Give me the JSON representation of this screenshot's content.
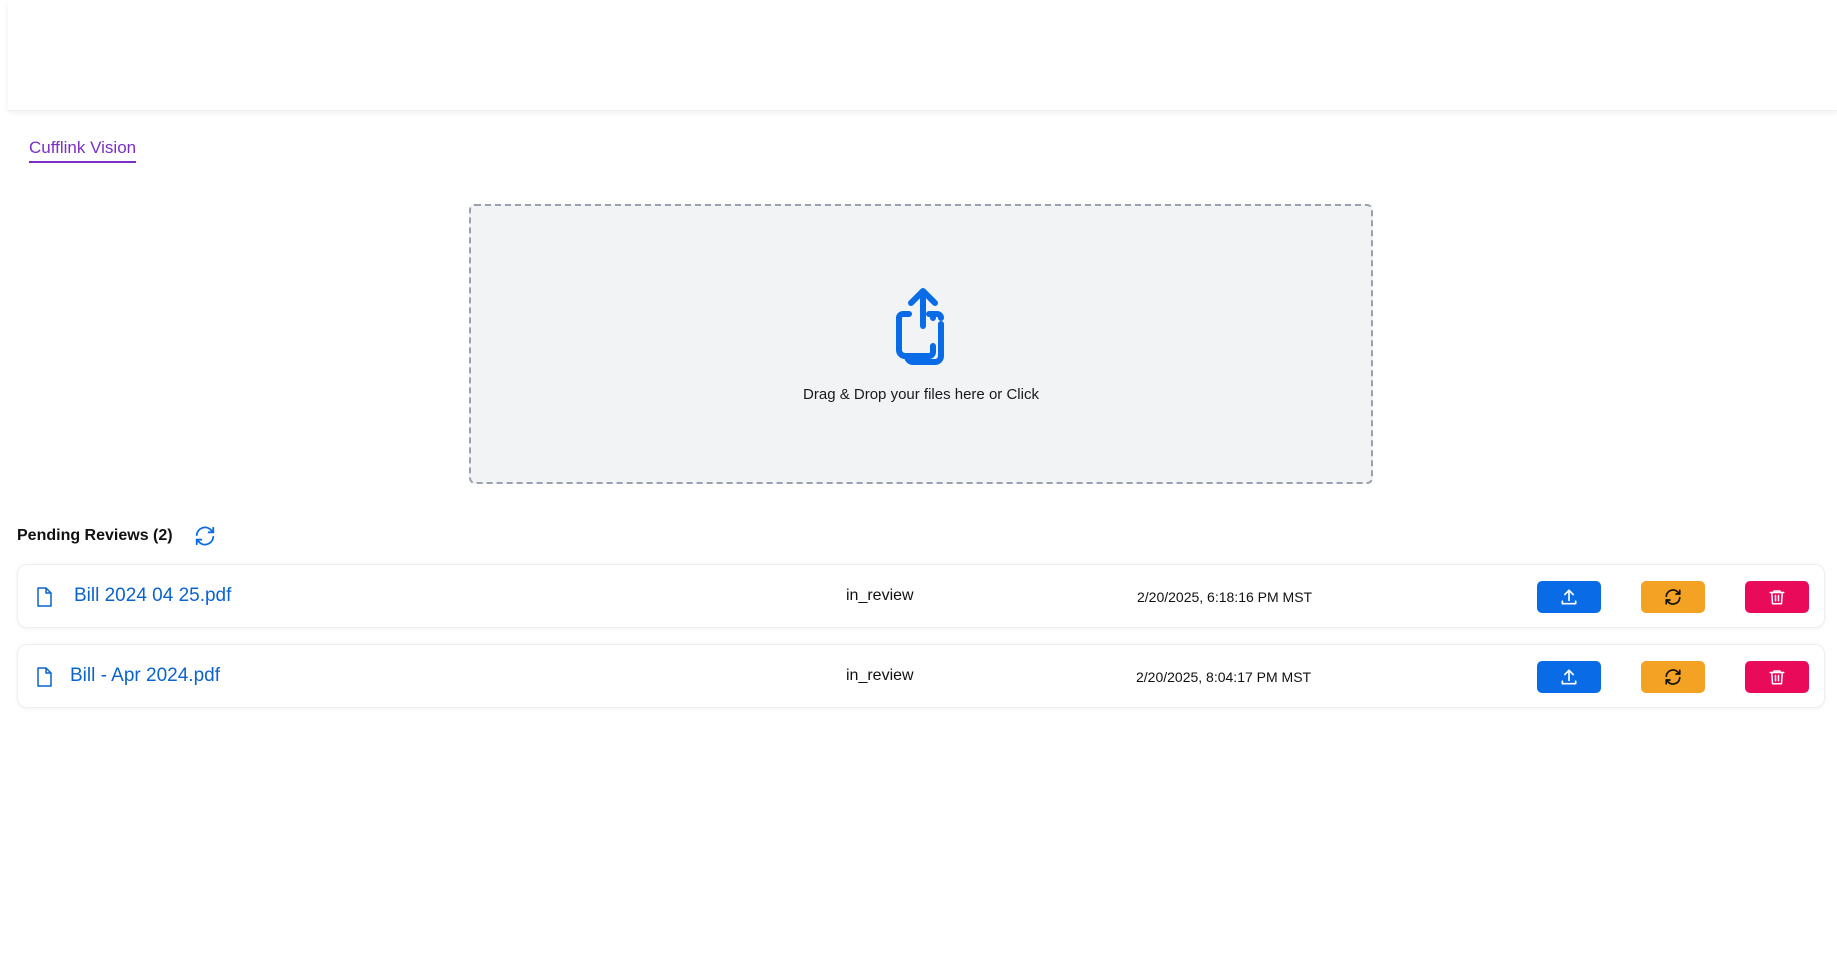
{
  "nav": {
    "tab_label": "Cufflink Vision"
  },
  "dropzone": {
    "text": "Drag & Drop your files here or Click",
    "icon": "upload-share-icon"
  },
  "pending": {
    "title": "Pending Reviews (2)",
    "refresh_icon": "refresh-icon",
    "rows": [
      {
        "file_name": "Bill 2024 04 25.pdf",
        "status": "in_review",
        "date": "2/20/2025, 6:18:16 PM MST"
      },
      {
        "file_name": "Bill - Apr 2024.pdf",
        "status": "in_review",
        "date": "2/20/2025, 8:04:17 PM MST"
      }
    ]
  },
  "colors": {
    "accent_purple": "#7b2fc9",
    "link_blue": "#0b63ce",
    "upload_button": "#0a6be6",
    "reprocess_button": "#f4a224",
    "delete_button": "#ea0a5a"
  }
}
